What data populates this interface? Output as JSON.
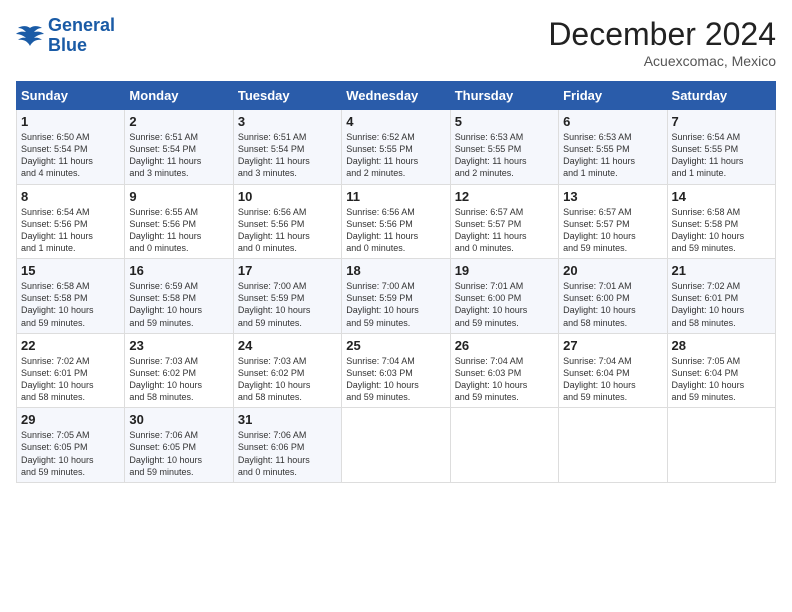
{
  "header": {
    "logo_line1": "General",
    "logo_line2": "Blue",
    "month_title": "December 2024",
    "location": "Acuexcomac, Mexico"
  },
  "days_of_week": [
    "Sunday",
    "Monday",
    "Tuesday",
    "Wednesday",
    "Thursday",
    "Friday",
    "Saturday"
  ],
  "weeks": [
    [
      {
        "day": "1",
        "info": "Sunrise: 6:50 AM\nSunset: 5:54 PM\nDaylight: 11 hours\nand 4 minutes."
      },
      {
        "day": "2",
        "info": "Sunrise: 6:51 AM\nSunset: 5:54 PM\nDaylight: 11 hours\nand 3 minutes."
      },
      {
        "day": "3",
        "info": "Sunrise: 6:51 AM\nSunset: 5:54 PM\nDaylight: 11 hours\nand 3 minutes."
      },
      {
        "day": "4",
        "info": "Sunrise: 6:52 AM\nSunset: 5:55 PM\nDaylight: 11 hours\nand 2 minutes."
      },
      {
        "day": "5",
        "info": "Sunrise: 6:53 AM\nSunset: 5:55 PM\nDaylight: 11 hours\nand 2 minutes."
      },
      {
        "day": "6",
        "info": "Sunrise: 6:53 AM\nSunset: 5:55 PM\nDaylight: 11 hours\nand 1 minute."
      },
      {
        "day": "7",
        "info": "Sunrise: 6:54 AM\nSunset: 5:55 PM\nDaylight: 11 hours\nand 1 minute."
      }
    ],
    [
      {
        "day": "8",
        "info": "Sunrise: 6:54 AM\nSunset: 5:56 PM\nDaylight: 11 hours\nand 1 minute."
      },
      {
        "day": "9",
        "info": "Sunrise: 6:55 AM\nSunset: 5:56 PM\nDaylight: 11 hours\nand 0 minutes."
      },
      {
        "day": "10",
        "info": "Sunrise: 6:56 AM\nSunset: 5:56 PM\nDaylight: 11 hours\nand 0 minutes."
      },
      {
        "day": "11",
        "info": "Sunrise: 6:56 AM\nSunset: 5:56 PM\nDaylight: 11 hours\nand 0 minutes."
      },
      {
        "day": "12",
        "info": "Sunrise: 6:57 AM\nSunset: 5:57 PM\nDaylight: 11 hours\nand 0 minutes."
      },
      {
        "day": "13",
        "info": "Sunrise: 6:57 AM\nSunset: 5:57 PM\nDaylight: 10 hours\nand 59 minutes."
      },
      {
        "day": "14",
        "info": "Sunrise: 6:58 AM\nSunset: 5:58 PM\nDaylight: 10 hours\nand 59 minutes."
      }
    ],
    [
      {
        "day": "15",
        "info": "Sunrise: 6:58 AM\nSunset: 5:58 PM\nDaylight: 10 hours\nand 59 minutes."
      },
      {
        "day": "16",
        "info": "Sunrise: 6:59 AM\nSunset: 5:58 PM\nDaylight: 10 hours\nand 59 minutes."
      },
      {
        "day": "17",
        "info": "Sunrise: 7:00 AM\nSunset: 5:59 PM\nDaylight: 10 hours\nand 59 minutes."
      },
      {
        "day": "18",
        "info": "Sunrise: 7:00 AM\nSunset: 5:59 PM\nDaylight: 10 hours\nand 59 minutes."
      },
      {
        "day": "19",
        "info": "Sunrise: 7:01 AM\nSunset: 6:00 PM\nDaylight: 10 hours\nand 59 minutes."
      },
      {
        "day": "20",
        "info": "Sunrise: 7:01 AM\nSunset: 6:00 PM\nDaylight: 10 hours\nand 58 minutes."
      },
      {
        "day": "21",
        "info": "Sunrise: 7:02 AM\nSunset: 6:01 PM\nDaylight: 10 hours\nand 58 minutes."
      }
    ],
    [
      {
        "day": "22",
        "info": "Sunrise: 7:02 AM\nSunset: 6:01 PM\nDaylight: 10 hours\nand 58 minutes."
      },
      {
        "day": "23",
        "info": "Sunrise: 7:03 AM\nSunset: 6:02 PM\nDaylight: 10 hours\nand 58 minutes."
      },
      {
        "day": "24",
        "info": "Sunrise: 7:03 AM\nSunset: 6:02 PM\nDaylight: 10 hours\nand 58 minutes."
      },
      {
        "day": "25",
        "info": "Sunrise: 7:04 AM\nSunset: 6:03 PM\nDaylight: 10 hours\nand 59 minutes."
      },
      {
        "day": "26",
        "info": "Sunrise: 7:04 AM\nSunset: 6:03 PM\nDaylight: 10 hours\nand 59 minutes."
      },
      {
        "day": "27",
        "info": "Sunrise: 7:04 AM\nSunset: 6:04 PM\nDaylight: 10 hours\nand 59 minutes."
      },
      {
        "day": "28",
        "info": "Sunrise: 7:05 AM\nSunset: 6:04 PM\nDaylight: 10 hours\nand 59 minutes."
      }
    ],
    [
      {
        "day": "29",
        "info": "Sunrise: 7:05 AM\nSunset: 6:05 PM\nDaylight: 10 hours\nand 59 minutes."
      },
      {
        "day": "30",
        "info": "Sunrise: 7:06 AM\nSunset: 6:05 PM\nDaylight: 10 hours\nand 59 minutes."
      },
      {
        "day": "31",
        "info": "Sunrise: 7:06 AM\nSunset: 6:06 PM\nDaylight: 11 hours\nand 0 minutes."
      },
      {
        "day": "",
        "info": ""
      },
      {
        "day": "",
        "info": ""
      },
      {
        "day": "",
        "info": ""
      },
      {
        "day": "",
        "info": ""
      }
    ]
  ]
}
